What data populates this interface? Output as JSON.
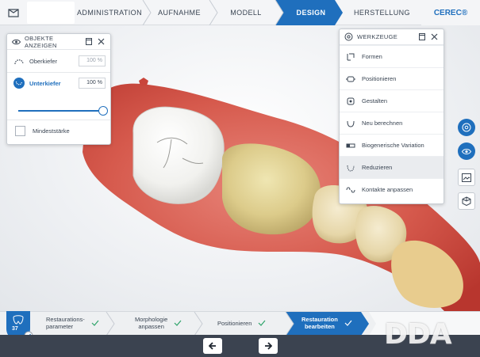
{
  "topbar": {
    "nav": [
      {
        "label": "ADMINISTRATION",
        "state": "done"
      },
      {
        "label": "AUFNAHME",
        "state": "done"
      },
      {
        "label": "MODELL",
        "state": "done"
      },
      {
        "label": "DESIGN",
        "state": "active"
      },
      {
        "label": "HERSTELLUNG",
        "state": "pending"
      }
    ],
    "brand": "CEREC®"
  },
  "objects_panel": {
    "title": "OBJEKTE ANZEIGEN",
    "items": [
      {
        "label": "Oberkiefer",
        "value": "100 %",
        "active": false
      },
      {
        "label": "Unterkiefer",
        "value": "100 %",
        "active": true
      }
    ],
    "slider_value": 1.0,
    "checkbox_label": "Mindeststärke",
    "checkbox_checked": false
  },
  "tools_panel": {
    "title": "WERKZEUGE",
    "items": [
      {
        "label": "Formen",
        "icon": "shape-icon"
      },
      {
        "label": "Positionieren",
        "icon": "position-icon"
      },
      {
        "label": "Gestalten",
        "icon": "sculpt-icon"
      },
      {
        "label": "Neu berechnen",
        "icon": "recalculate-icon"
      },
      {
        "label": "Biogenerische Variation",
        "icon": "variation-icon"
      },
      {
        "label": "Reduzieren",
        "icon": "reduce-icon",
        "highlighted": true
      },
      {
        "label": "Kontakte anpassen",
        "icon": "contacts-icon"
      }
    ]
  },
  "side_tools": [
    "material-icon",
    "view-icon",
    "screenshot-icon",
    "cube-icon"
  ],
  "phases": {
    "tooth_number": "37",
    "steps": [
      {
        "label": "Restaurations-\nparameter",
        "state": "done"
      },
      {
        "label": "Morphologie\nanpassen",
        "state": "done"
      },
      {
        "label": "Positionieren",
        "state": "done"
      },
      {
        "label": "Restauration\nbearbeiten",
        "state": "active"
      }
    ]
  },
  "footer": {
    "back": "previous-icon",
    "next": "next-icon"
  },
  "watermark": "DDA",
  "colors": {
    "accent": "#1f6fbd",
    "footer": "#3b4350",
    "gum": "#d4554a",
    "crown": "#f7f7f5"
  }
}
